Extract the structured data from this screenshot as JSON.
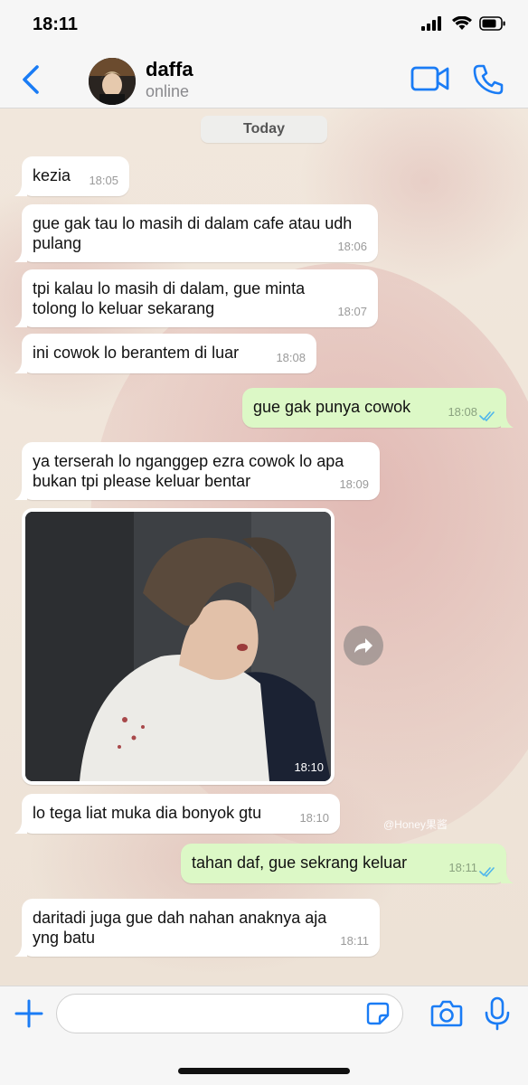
{
  "status_bar": {
    "time": "18:11",
    "icons": [
      "cellular-signal-icon",
      "wifi-icon",
      "battery-icon"
    ]
  },
  "header": {
    "back_icon": "chevron-left-icon",
    "contact_name": "daffa",
    "contact_status": "online",
    "video_icon": "video-camera-icon",
    "call_icon": "phone-icon",
    "accent": "#1a7cf5"
  },
  "chat": {
    "date_label": "Today",
    "messages": [
      {
        "direction": "in",
        "text": "kezia",
        "time": "18:05"
      },
      {
        "direction": "in",
        "text": "gue gak tau lo masih di dalam cafe atau udh pulang",
        "time": "18:06"
      },
      {
        "direction": "in",
        "text": "tpi kalau lo masih di dalam, gue minta tolong lo keluar sekarang",
        "time": "18:07"
      },
      {
        "direction": "in",
        "text": "ini cowok lo berantem di luar",
        "time": "18:08"
      },
      {
        "direction": "out",
        "text": "gue gak punya cowok",
        "time": "18:08",
        "status": "read"
      },
      {
        "direction": "in",
        "text": "ya terserah lo nganggep ezra cowok lo apa bukan tpi please keluar bentar",
        "time": "18:09"
      },
      {
        "direction": "in",
        "type": "image",
        "time": "18:10"
      },
      {
        "direction": "in",
        "text": "lo tega liat muka dia bonyok gtu",
        "time": "18:10"
      },
      {
        "direction": "out",
        "text": "tahan daf, gue sekrang keluar",
        "time": "18:11",
        "status": "read"
      },
      {
        "direction": "in",
        "text": "daritadi juga gue dah nahan anaknya aja yng batu",
        "time": "18:11"
      }
    ],
    "forward_icon": "forward-arrow-icon",
    "watermark": "@Honey果酱",
    "colors": {
      "incoming": "#ffffff",
      "outgoing": "#dcf8c6",
      "read_ticks": "#4fb6ec"
    }
  },
  "composer": {
    "plus_icon": "plus-icon",
    "input_value": "",
    "input_placeholder": "",
    "sticker_icon": "sticker-icon",
    "camera_icon": "camera-icon",
    "mic_icon": "microphone-icon"
  }
}
